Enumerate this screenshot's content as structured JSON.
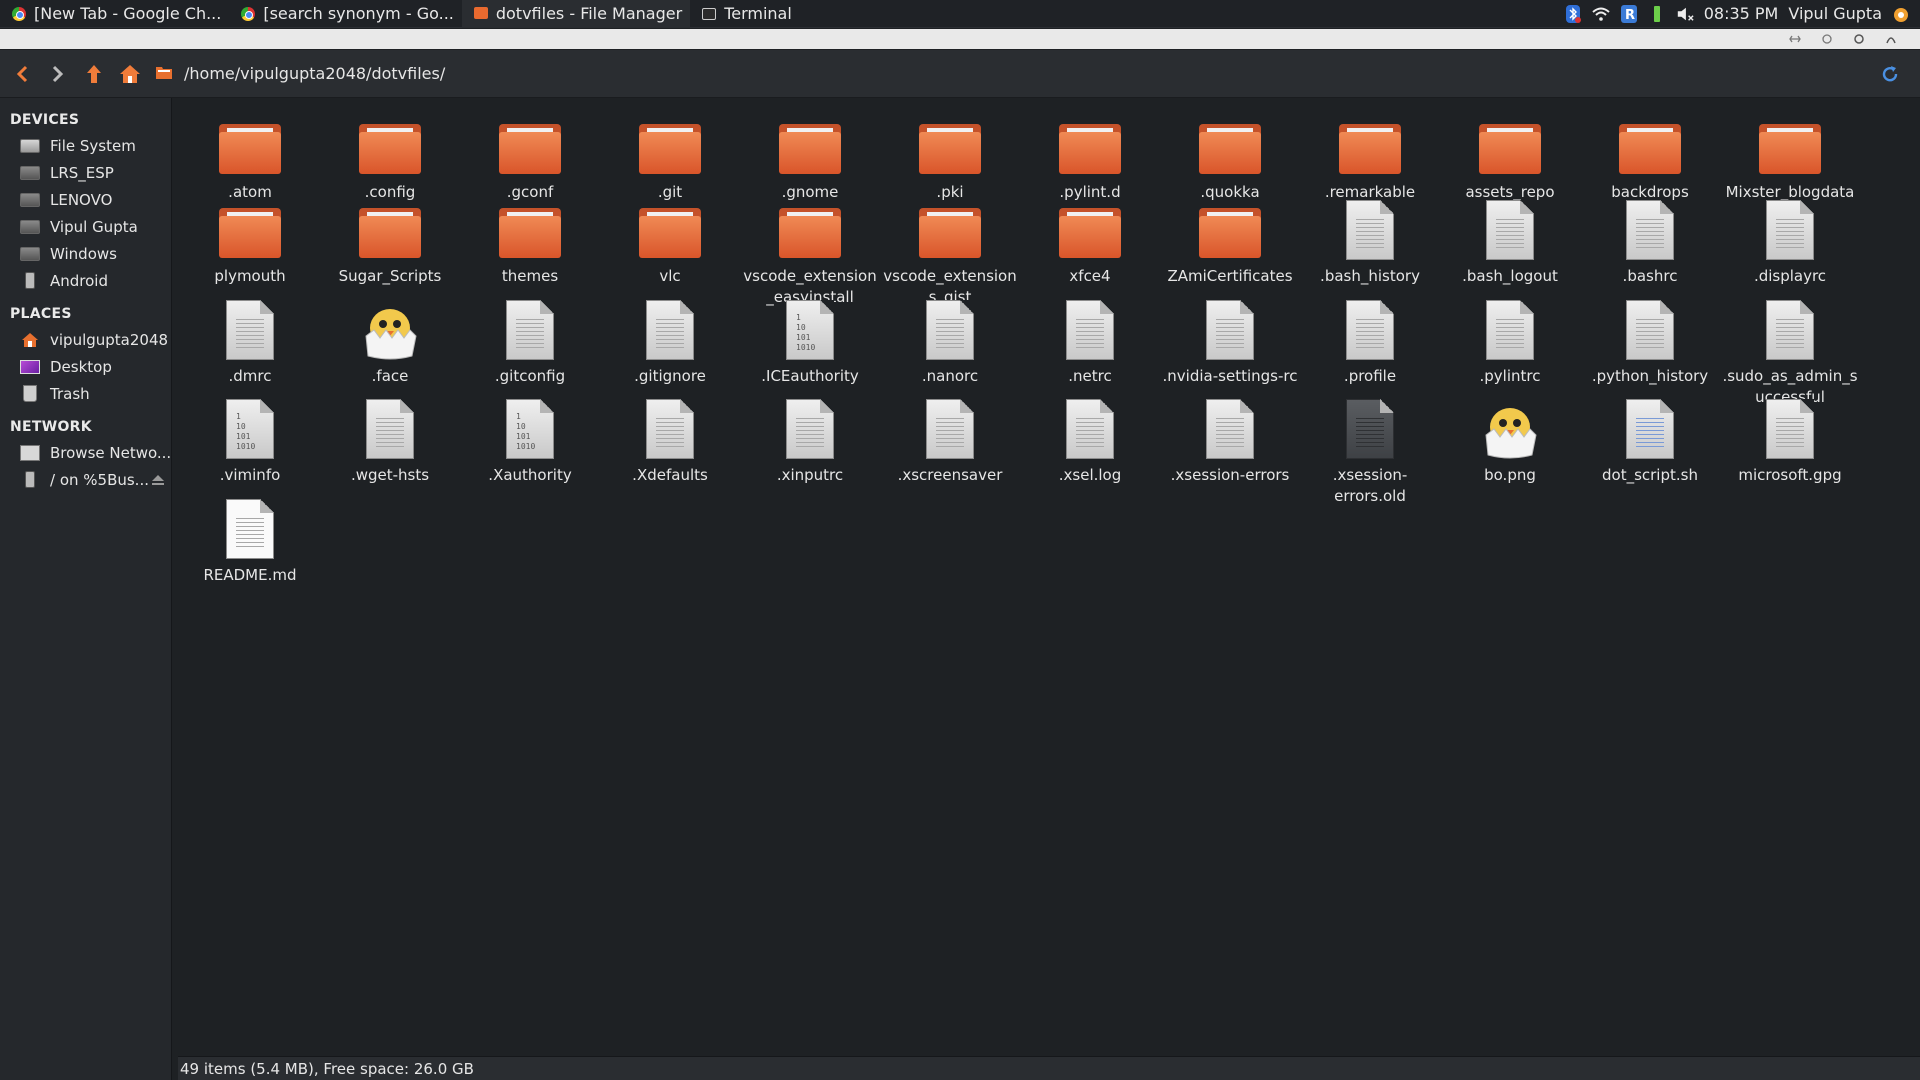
{
  "taskbar": {
    "tasks": [
      {
        "label": "[New Tab - Google Ch...",
        "icon": "chrome-icon"
      },
      {
        "label": "[search synonym - Go...",
        "icon": "chrome-icon"
      },
      {
        "label": "dotvfiles - File Manager",
        "icon": "folder-icon",
        "active": true
      },
      {
        "label": "Terminal",
        "icon": "terminal-icon"
      }
    ],
    "clock": "08:35 PM",
    "user": "Vipul Gupta"
  },
  "toolbar": {
    "path": "/home/vipulgupta2048/dotvfiles/"
  },
  "sidebar": {
    "devices_heading": "DEVICES",
    "devices": [
      "File System",
      "LRS_ESP",
      "LENOVO",
      "Vipul Gupta",
      "Windows",
      "Android"
    ],
    "places_heading": "PLACES",
    "places": [
      "vipulgupta2048",
      "Desktop",
      "Trash"
    ],
    "network_heading": "NETWORK",
    "network": [
      "Browse Netwo...",
      "/ on %5Bus..."
    ]
  },
  "files": [
    {
      "name": ".atom",
      "type": "folder"
    },
    {
      "name": ".config",
      "type": "folder"
    },
    {
      "name": ".gconf",
      "type": "folder"
    },
    {
      "name": ".git",
      "type": "folder"
    },
    {
      "name": ".gnome",
      "type": "folder"
    },
    {
      "name": ".pki",
      "type": "folder"
    },
    {
      "name": ".pylint.d",
      "type": "folder"
    },
    {
      "name": ".quokka",
      "type": "folder"
    },
    {
      "name": ".remarkable",
      "type": "folder"
    },
    {
      "name": "assets_repo",
      "type": "folder"
    },
    {
      "name": "backdrops",
      "type": "folder"
    },
    {
      "name": "Mixster_blogdata",
      "type": "folder"
    },
    {
      "name": "plymouth",
      "type": "folder"
    },
    {
      "name": "Sugar_Scripts",
      "type": "folder"
    },
    {
      "name": "themes",
      "type": "folder"
    },
    {
      "name": "vlc",
      "type": "folder"
    },
    {
      "name": "vscode_extension_easyinstall",
      "type": "folder"
    },
    {
      "name": "vscode_extensions_gist",
      "type": "folder"
    },
    {
      "name": "xfce4",
      "type": "folder"
    },
    {
      "name": "ZAmiCertificates",
      "type": "folder"
    },
    {
      "name": ".bash_history",
      "type": "file"
    },
    {
      "name": ".bash_logout",
      "type": "file"
    },
    {
      "name": ".bashrc",
      "type": "file"
    },
    {
      "name": ".displayrc",
      "type": "file"
    },
    {
      "name": ".dmrc",
      "type": "file"
    },
    {
      "name": ".face",
      "type": "image"
    },
    {
      "name": ".gitconfig",
      "type": "file"
    },
    {
      "name": ".gitignore",
      "type": "file"
    },
    {
      "name": ".ICEauthority",
      "type": "binary"
    },
    {
      "name": ".nanorc",
      "type": "file"
    },
    {
      "name": ".netrc",
      "type": "file"
    },
    {
      "name": ".nvidia-settings-rc",
      "type": "file"
    },
    {
      "name": ".profile",
      "type": "file"
    },
    {
      "name": ".pylintrc",
      "type": "file"
    },
    {
      "name": ".python_history",
      "type": "file"
    },
    {
      "name": ".sudo_as_admin_successful",
      "type": "file"
    },
    {
      "name": ".viminfo",
      "type": "binary"
    },
    {
      "name": ".wget-hsts",
      "type": "file"
    },
    {
      "name": ".Xauthority",
      "type": "binary"
    },
    {
      "name": ".Xdefaults",
      "type": "file"
    },
    {
      "name": ".xinputrc",
      "type": "file"
    },
    {
      "name": ".xscreensaver",
      "type": "file"
    },
    {
      "name": ".xsel.log",
      "type": "file"
    },
    {
      "name": ".xsession-errors",
      "type": "file"
    },
    {
      "name": ".xsession-errors.old",
      "type": "dark-file"
    },
    {
      "name": "bo.png",
      "type": "image"
    },
    {
      "name": "dot_script.sh",
      "type": "script"
    },
    {
      "name": "microsoft.gpg",
      "type": "file"
    },
    {
      "name": "README.md",
      "type": "readme"
    }
  ],
  "binary_glyph": "1\n10\n101\n1010",
  "statusbar": {
    "text": "49 items (5.4 MB), Free space: 26.0 GB"
  }
}
